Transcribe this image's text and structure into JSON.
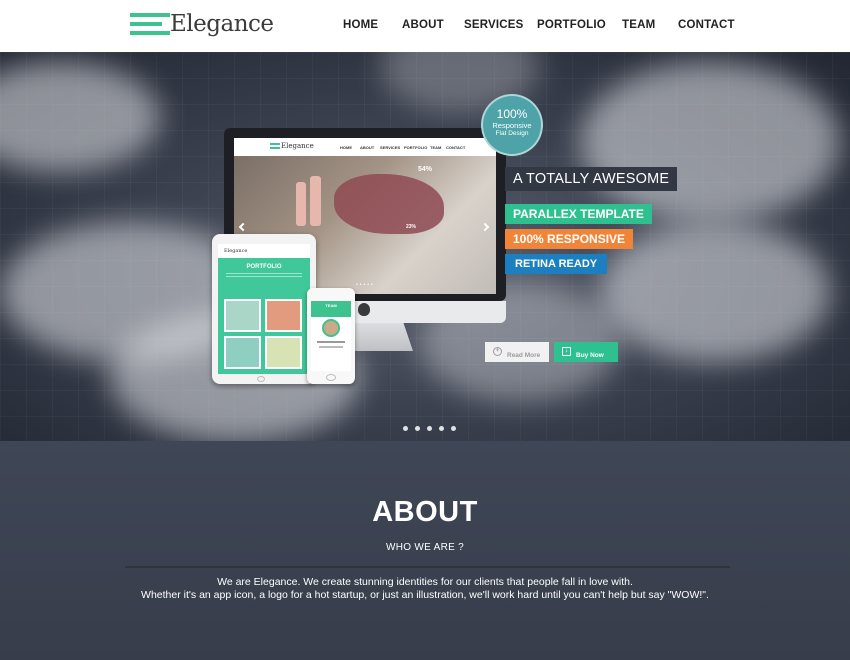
{
  "nav": {
    "logo_text": "Elegance",
    "items": [
      "HOME",
      "ABOUT",
      "SERVICES",
      "PORTFOLIO",
      "TEAM",
      "CONTACT"
    ]
  },
  "hero": {
    "badge": {
      "big": "100%",
      "line1": "Responsive",
      "line2": "Flat Design"
    },
    "tagline": "A TOTALLY AWESOME",
    "labels": {
      "parallax": "PARALLEX TEMPLATE",
      "responsive": "100% RESPONSIVE",
      "retina": "RETINA READY"
    },
    "buttons": {
      "read_more": "Read More",
      "buy_now": "Buy Now"
    },
    "slide_count": 5,
    "colors": {
      "green": "#2fc090",
      "orange": "#f08539",
      "blue": "#1b7fc0",
      "teal": "#4da3a8"
    }
  },
  "mockup": {
    "monitor_logo": "Elegance",
    "monitor_menu": [
      "HOME",
      "ABOUT",
      "SERVICES",
      "PORTFOLIO",
      "TEAM",
      "CONTACT"
    ],
    "pct_a": "54%",
    "pct_b": "23%",
    "tablet_logo": "Elegance",
    "tablet_title": "PORTFOLIO",
    "phone_title": "TEAM"
  },
  "about": {
    "title": "ABOUT",
    "subtitle": "WHO WE ARE ?",
    "line1": "We are Elegance. We create stunning identities for our clients that people fall in love with.",
    "line2": "Whether it's an app icon, a logo for a hot startup, or just an illustration, we'll work hard until you can't help but say \"WOW!\"."
  }
}
